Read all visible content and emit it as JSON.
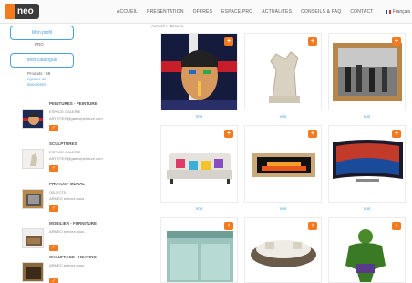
{
  "brand": {
    "logo_text": "neo"
  },
  "nav": {
    "items": [
      "ACCUEIL",
      "PRESENTATION",
      "OFFRES",
      "ESPACE PRO",
      "ACTUALITES",
      "CONSEILS & FAQ",
      "CONTACT"
    ],
    "language": "Français"
  },
  "sidebar": {
    "profile_button": "Mon profil",
    "profile_sub": "PRO",
    "catalog_button": "Mon catalogue",
    "products_label": "Produits : 49",
    "link_add": "Ajouter un",
    "link_add2": "document",
    "sellers": [
      {
        "title": "PEINTURES - PEINTURE",
        "line1": "ESPACE GALERIE",
        "line2": "ARTISTES@galeriepeinture.com",
        "tag": "✓"
      },
      {
        "title": "SCULPTURES",
        "line1": "ESPACE GALERIE",
        "line2": "ARTISTES@galeriepeinture.com",
        "tag": "✓"
      },
      {
        "title": "PHOTOS - MURAL",
        "line1": "OBJECTS",
        "line2": "ARMEO ecrivez nous",
        "tag": "✓"
      },
      {
        "title": "MOBILIER - FURNITURE",
        "line1": "ARMEO ecrivez nous",
        "line2": "",
        "tag": "✓"
      },
      {
        "title": "CHAUFFAGE - HEATING",
        "line1": "ARMEO ecrivez nous",
        "line2": "",
        "tag": "✓"
      }
    ]
  },
  "main": {
    "breadcrumb": "Accueil > Œuvres",
    "badge": "+",
    "tile_link": "Voir",
    "tiles": [
      {
        "name": "pop-art-portrait"
      },
      {
        "name": "hand-sculpture"
      },
      {
        "name": "framed-photo"
      },
      {
        "name": "sofa"
      },
      {
        "name": "fireplace"
      },
      {
        "name": "television"
      },
      {
        "name": "range-cooker"
      },
      {
        "name": "round-sofa"
      },
      {
        "name": "hulk-figure"
      }
    ]
  },
  "colors": {
    "accent": "#f47a20",
    "link": "#4aa3d8"
  }
}
